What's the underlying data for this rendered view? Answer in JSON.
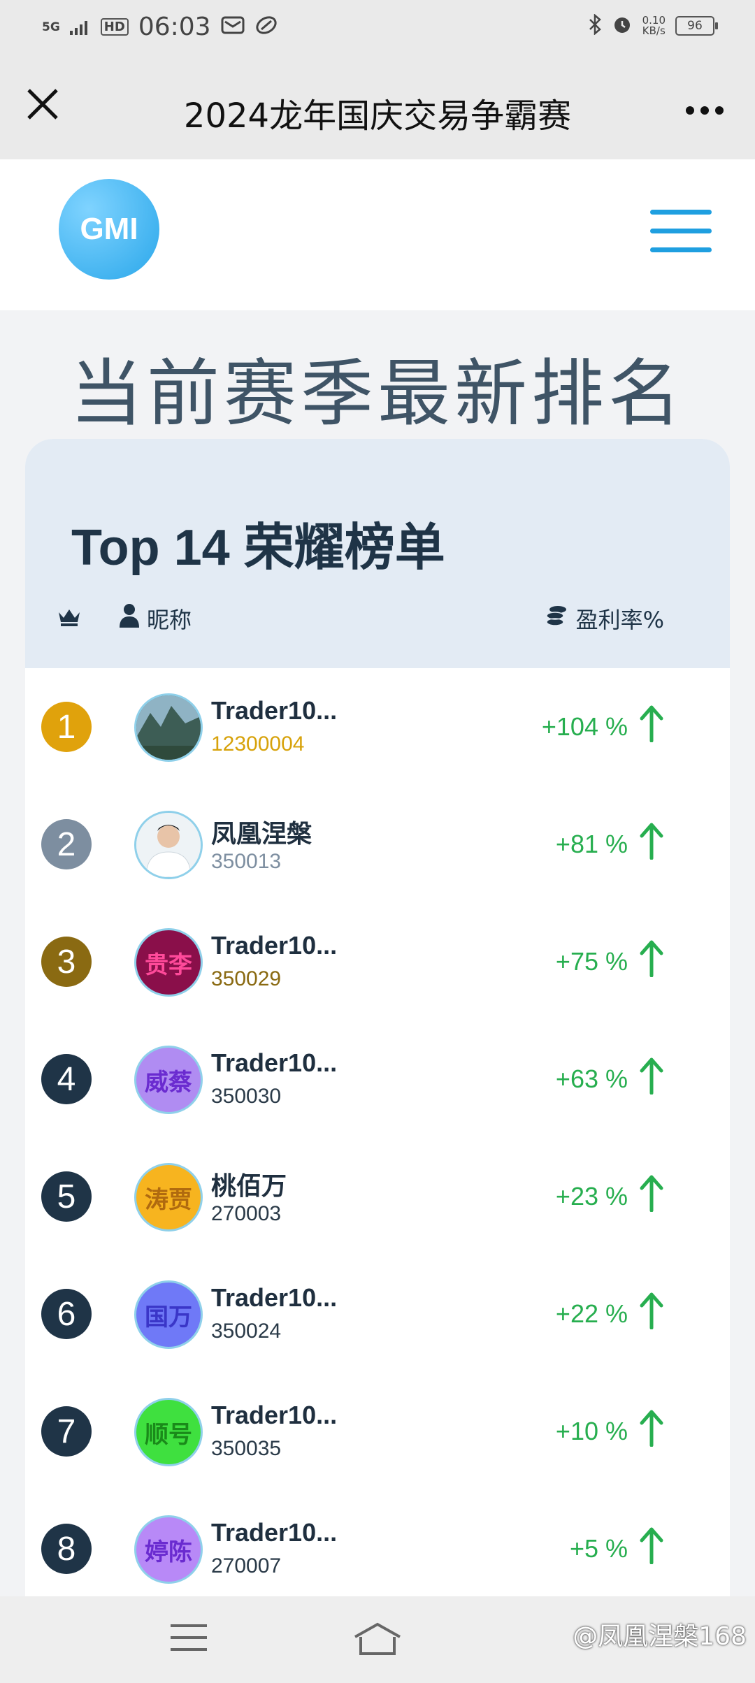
{
  "status_bar": {
    "network": "5G",
    "hd": "HD",
    "time": "06:03",
    "speed": "0.10\nKB/s",
    "battery": "96"
  },
  "navbar": {
    "title": "2024龙年国庆交易争霸赛"
  },
  "header": {
    "logo_text": "GMI"
  },
  "section_title": "当前赛季最新排名",
  "leaderboard": {
    "title": "Top 14 荣耀榜单",
    "col_name": "昵称",
    "col_profit": "盈利率%",
    "rows": [
      {
        "rank": "1",
        "name": "Trader10...",
        "id": "12300004",
        "profit": "+104 %",
        "rank_color": "#e0a20c",
        "id_color": "#d7a20a",
        "avatar_text": "",
        "avatar_bg": "#4b6e6a",
        "avatar_color": "#ffffff"
      },
      {
        "rank": "2",
        "name": "凤凰涅槃",
        "id": "350013",
        "profit": "+81 %",
        "rank_color": "#7d8ea0",
        "id_color": "#7d8ea0",
        "avatar_text": "",
        "avatar_bg": "#dfe8ee",
        "avatar_color": "#ffffff"
      },
      {
        "rank": "3",
        "name": "Trader10...",
        "id": "350029",
        "profit": "+75 %",
        "rank_color": "#8a6a12",
        "id_color": "#8a6a12",
        "avatar_text": "贵李",
        "avatar_bg": "#8a0f4a",
        "avatar_color": "#ff4a9a"
      },
      {
        "rank": "4",
        "name": "Trader10...",
        "id": "350030",
        "profit": "+63 %",
        "rank_color": "#1f3447",
        "id_color": "#2a3a48",
        "avatar_text": "威蔡",
        "avatar_bg": "#b08cf2",
        "avatar_color": "#6a2bd0"
      },
      {
        "rank": "5",
        "name": "桃佰万",
        "id": "270003",
        "profit": "+23 %",
        "rank_color": "#1f3447",
        "id_color": "#2a3a48",
        "avatar_text": "涛贾",
        "avatar_bg": "#f7b41f",
        "avatar_color": "#b06a0f"
      },
      {
        "rank": "6",
        "name": "Trader10...",
        "id": "350024",
        "profit": "+22 %",
        "rank_color": "#1f3447",
        "id_color": "#2a3a48",
        "avatar_text": "国万",
        "avatar_bg": "#6f79f7",
        "avatar_color": "#3a36c8"
      },
      {
        "rank": "7",
        "name": "Trader10...",
        "id": "350035",
        "profit": "+10 %",
        "rank_color": "#1f3447",
        "id_color": "#2a3a48",
        "avatar_text": "顺号",
        "avatar_bg": "#3fe03f",
        "avatar_color": "#1a8a1a"
      },
      {
        "rank": "8",
        "name": "Trader10...",
        "id": "270007",
        "profit": "+5 %",
        "rank_color": "#1f3447",
        "id_color": "#2a3a48",
        "avatar_text": "婷陈",
        "avatar_bg": "#b889f7",
        "avatar_color": "#6a2bd0"
      }
    ]
  },
  "watermark": "@凤凰涅槃168",
  "colors": {
    "accent": "#1f9fe0",
    "profit_green": "#27ae4f",
    "card_head": "#e3ebf4"
  }
}
